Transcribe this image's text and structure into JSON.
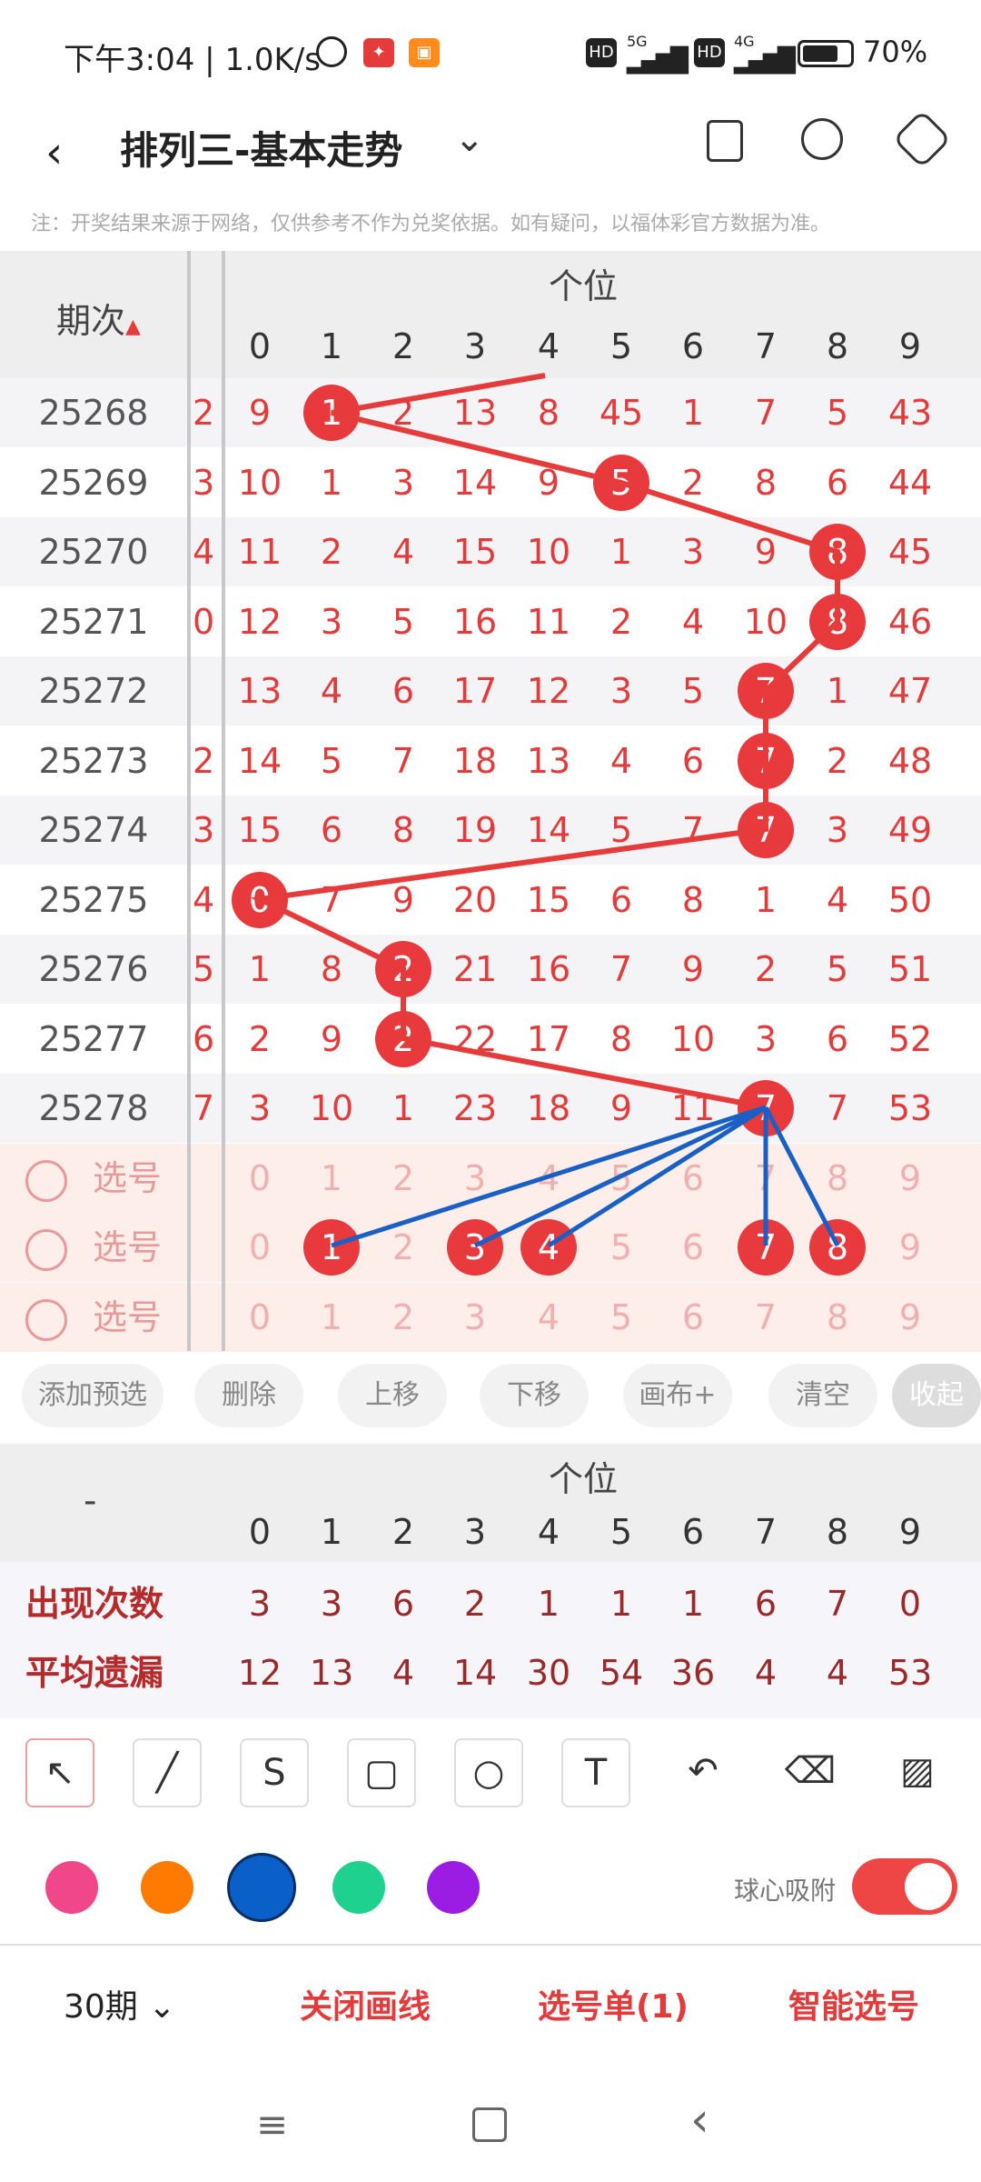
{
  "status_bar": {
    "time": "下午3:04",
    "speed": "1.0K/s",
    "network1": "5G",
    "network2": "4G",
    "battery": "70%"
  },
  "header": {
    "title": "排列三-基本走势"
  },
  "note": "注：开奖结果来源于网络，仅供参考不作为兑奖依据。如有疑问，以福体彩官方数据为准。",
  "table": {
    "period_header": "期次",
    "group_header": "个位",
    "digits": [
      "0",
      "1",
      "2",
      "3",
      "4",
      "5",
      "6",
      "7",
      "8",
      "9"
    ],
    "rows": [
      {
        "period": "25268",
        "left": "2",
        "cells": [
          "9",
          "1",
          "2",
          "13",
          "8",
          "45",
          "1",
          "7",
          "5",
          "43"
        ]
      },
      {
        "period": "25269",
        "left": "3",
        "cells": [
          "10",
          "1",
          "3",
          "14",
          "9",
          "5",
          "2",
          "8",
          "6",
          "44"
        ]
      },
      {
        "period": "25270",
        "left": "4",
        "cells": [
          "11",
          "2",
          "4",
          "15",
          "10",
          "1",
          "3",
          "9",
          "8",
          "45"
        ]
      },
      {
        "period": "25271",
        "left": "0",
        "cells": [
          "12",
          "3",
          "5",
          "16",
          "11",
          "2",
          "4",
          "10",
          "8",
          "46"
        ]
      },
      {
        "period": "25272",
        "left": "",
        "cells": [
          "13",
          "4",
          "6",
          "17",
          "12",
          "3",
          "5",
          "7",
          "1",
          "47"
        ]
      },
      {
        "period": "25273",
        "left": "2",
        "cells": [
          "14",
          "5",
          "7",
          "18",
          "13",
          "4",
          "6",
          "7",
          "2",
          "48"
        ]
      },
      {
        "period": "25274",
        "left": "3",
        "cells": [
          "15",
          "6",
          "8",
          "19",
          "14",
          "5",
          "7",
          "7",
          "3",
          "49"
        ]
      },
      {
        "period": "25275",
        "left": "4",
        "cells": [
          "0",
          "7",
          "9",
          "20",
          "15",
          "6",
          "8",
          "1",
          "4",
          "50"
        ]
      },
      {
        "period": "25276",
        "left": "5",
        "cells": [
          "1",
          "8",
          "2",
          "21",
          "16",
          "7",
          "9",
          "2",
          "5",
          "51"
        ]
      },
      {
        "period": "25277",
        "left": "6",
        "cells": [
          "2",
          "9",
          "2",
          "22",
          "17",
          "8",
          "10",
          "3",
          "6",
          "52"
        ]
      },
      {
        "period": "25278",
        "left": "7",
        "cells": [
          "3",
          "10",
          "1",
          "23",
          "18",
          "9",
          "11",
          "7",
          "7",
          "53"
        ]
      }
    ],
    "pick_label": "选号"
  },
  "buttons": [
    "添加预选",
    "删除",
    "上移",
    "下移",
    "画布+",
    "清空",
    "收起"
  ],
  "stats": {
    "dash": "-",
    "group_header": "个位",
    "rows": [
      {
        "label": "出现次数",
        "values": [
          "3",
          "3",
          "6",
          "2",
          "1",
          "1",
          "1",
          "6",
          "7",
          "0"
        ]
      },
      {
        "label": "平均遗漏",
        "values": [
          "12",
          "13",
          "4",
          "14",
          "30",
          "54",
          "36",
          "4",
          "4",
          "53"
        ]
      }
    ]
  },
  "tools": [
    "pointer-icon",
    "line-icon",
    "curve-icon",
    "rectangle-icon",
    "circle-icon",
    "text-icon",
    "undo-icon",
    "eraser-icon",
    "clear-brush-icon"
  ],
  "colors": [
    "#f0468a",
    "#ff7a00",
    "#0a60c8",
    "#1ed18f",
    "#9b1de3"
  ],
  "snap": {
    "label": "球心吸附",
    "on": true
  },
  "bottom": {
    "periods": "30期",
    "close_lines": "关闭画线",
    "pick_list": "选号单(1)",
    "smart_pick": "智能选号"
  }
}
